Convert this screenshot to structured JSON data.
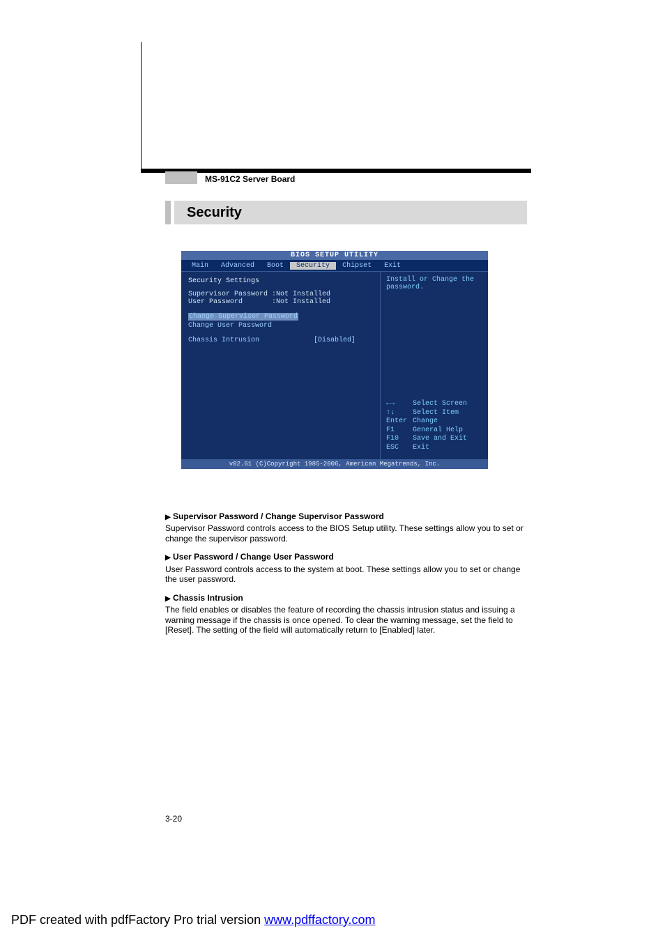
{
  "header": {
    "board_title": "MS-91C2 Server Board",
    "section_title": "Security"
  },
  "bios": {
    "title": "BIOS SETUP UTILITY",
    "tabs": [
      "Main",
      "Advanced",
      "Boot",
      "Security",
      "Chipset",
      "Exit"
    ],
    "active_tab": "Security",
    "left": {
      "heading": "Security Settings",
      "rows": [
        {
          "label": "Supervisor Password",
          "value": ":Not Installed"
        },
        {
          "label": "User Password",
          "value": ":Not Installed"
        }
      ],
      "links": [
        "Change Supervisor Password",
        "Change User Password"
      ],
      "option": {
        "label": "Chassis Intrusion",
        "value": "[Disabled]"
      }
    },
    "right": {
      "help_text": "Install or Change the password.",
      "nav": [
        {
          "key": "←→",
          "action": "Select Screen"
        },
        {
          "key": "↑↓",
          "action": "Select Item"
        },
        {
          "key": "Enter",
          "action": "Change"
        },
        {
          "key": "F1",
          "action": "General Help"
        },
        {
          "key": "F10",
          "action": "Save and Exit"
        },
        {
          "key": "ESC",
          "action": "Exit"
        }
      ]
    },
    "footer": "v02.61 (C)Copyright 1985-2006, American Megatrends, Inc."
  },
  "descriptions": {
    "items": [
      {
        "title": "Supervisor Password / Change Supervisor Password",
        "body": "Supervisor Password controls access to the BIOS Setup utility. These settings allow you to set or change the supervisor password."
      },
      {
        "title": "User Password / Change User Password",
        "body": "User Password controls access to the system at boot. These settings allow you to set or change the user password."
      },
      {
        "title": "Chassis Intrusion",
        "body": "The field enables or disables the feature of recording the chassis intrusion status and issuing a warning message if the chassis is once opened. To clear the warning message, set the field to [Reset]. The setting of the field will automatically return to [Enabled] later."
      }
    ]
  },
  "page_number": "3-20",
  "pdf_footer": {
    "prefix": "PDF created with pdfFactory Pro trial version ",
    "link_text": "www.pdffactory.com"
  }
}
